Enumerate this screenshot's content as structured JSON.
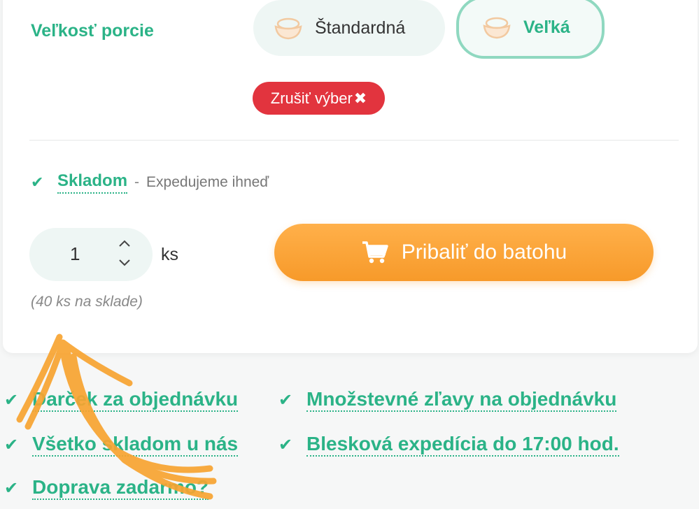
{
  "portion": {
    "label": "Veľkosť porcie",
    "options": [
      {
        "label": "Štandardná",
        "selected": false
      },
      {
        "label": "Veľká",
        "selected": true
      }
    ],
    "clear_label": "Zrušiť výber",
    "clear_icon": "close-icon"
  },
  "stock": {
    "status": "Skladom",
    "separator": "-",
    "note": "Expedujeme ihneď"
  },
  "quantity": {
    "value": "1",
    "unit": "ks",
    "available": "(40 ks na sklade)"
  },
  "cart": {
    "button_label": "Pribaliť do batohu",
    "icon": "cart-icon"
  },
  "benefits": [
    "Darček za objednávku",
    "Množstevné zľavy na objednávku",
    "Všetko skladom u nás",
    "Blesková expedícia do 17:00 hod.",
    "Doprava zadarmo?"
  ],
  "colors": {
    "accent": "#2bb387",
    "orange": "#f79a2a",
    "danger": "#e2343e"
  }
}
